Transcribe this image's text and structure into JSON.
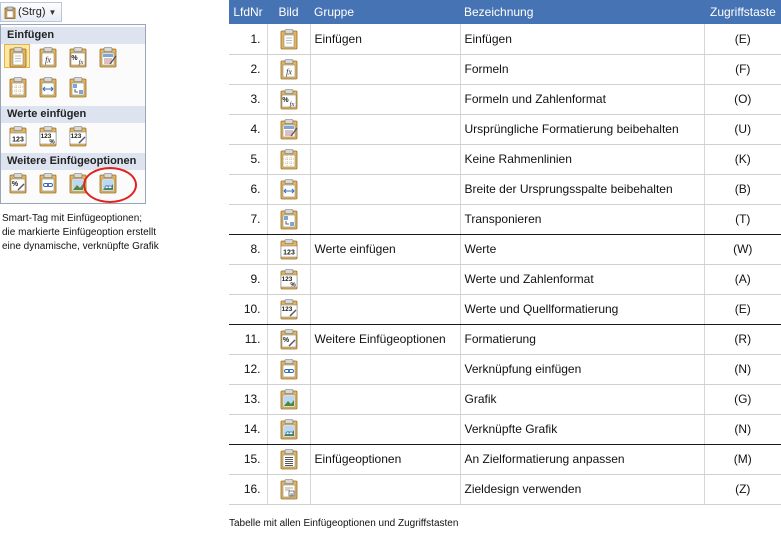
{
  "smart_tag": {
    "button_label": "(Strg)",
    "sections": [
      {
        "title": "Einfügen",
        "icons": [
          "paste-icon",
          "formula-fx-icon",
          "formula-number-format-icon",
          "keep-source-formatting-icon",
          "no-borders-icon",
          "keep-source-column-width-icon",
          "transpose-icon"
        ]
      },
      {
        "title": "Werte einfügen",
        "icons": [
          "values-icon",
          "values-number-format-icon",
          "values-source-formatting-icon"
        ]
      },
      {
        "title": "Weitere Einfügeoptionen",
        "icons": [
          "formatting-icon",
          "paste-link-icon",
          "picture-icon",
          "linked-picture-icon"
        ]
      }
    ],
    "caption": [
      "Smart-Tag mit Einfügeoptionen;",
      "die markierte Einfügeoption erstellt",
      "eine dynamische, verknüpfte Grafik"
    ]
  },
  "table": {
    "headers": {
      "nr": "LfdNr",
      "bild": "Bild",
      "gruppe": "Gruppe",
      "bezeichnung": "Bezeichnung",
      "taste": "Zugriffstaste"
    },
    "rows": [
      {
        "nr": "1.",
        "icon": "paste-icon",
        "gruppe": "Einfügen",
        "bezeichnung": "Einfügen",
        "taste": "(E)"
      },
      {
        "nr": "2.",
        "icon": "formula-fx-icon",
        "gruppe": "",
        "bezeichnung": "Formeln",
        "taste": "(F)"
      },
      {
        "nr": "3.",
        "icon": "formula-number-format-icon",
        "gruppe": "",
        "bezeichnung": "Formeln und Zahlenformat",
        "taste": "(O)"
      },
      {
        "nr": "4.",
        "icon": "keep-source-formatting-icon",
        "gruppe": "",
        "bezeichnung": "Ursprüngliche Formatierung beibehalten",
        "taste": "(U)"
      },
      {
        "nr": "5.",
        "icon": "no-borders-icon",
        "gruppe": "",
        "bezeichnung": "Keine Rahmenlinien",
        "taste": "(K)"
      },
      {
        "nr": "6.",
        "icon": "keep-source-column-width-icon",
        "gruppe": "",
        "bezeichnung": "Breite der Ursprungsspalte beibehalten",
        "taste": "(B)"
      },
      {
        "nr": "7.",
        "icon": "transpose-icon",
        "gruppe": "",
        "bezeichnung": "Transponieren",
        "taste": "(T)"
      },
      {
        "nr": "8.",
        "icon": "values-icon",
        "gruppe": "Werte einfügen",
        "bezeichnung": "Werte",
        "taste": "(W)"
      },
      {
        "nr": "9.",
        "icon": "values-number-format-icon",
        "gruppe": "",
        "bezeichnung": "Werte und Zahlenformat",
        "taste": "(A)"
      },
      {
        "nr": "10.",
        "icon": "values-source-formatting-icon",
        "gruppe": "",
        "bezeichnung": "Werte und Quellformatierung",
        "taste": "(E)"
      },
      {
        "nr": "11.",
        "icon": "formatting-icon",
        "gruppe": "Weitere Einfügeoptionen",
        "bezeichnung": "Formatierung",
        "taste": "(R)"
      },
      {
        "nr": "12.",
        "icon": "paste-link-icon",
        "gruppe": "",
        "bezeichnung": "Verknüpfung einfügen",
        "taste": "(N)"
      },
      {
        "nr": "13.",
        "icon": "picture-icon",
        "gruppe": "",
        "bezeichnung": "Grafik",
        "taste": "(G)"
      },
      {
        "nr": "14.",
        "icon": "linked-picture-icon",
        "gruppe": "",
        "bezeichnung": "Verknüpfte Grafik",
        "taste": "(N)"
      },
      {
        "nr": "15.",
        "icon": "match-destination-formatting-icon",
        "gruppe": "Einfügeoptionen",
        "bezeichnung": "An Zielformatierung anpassen",
        "taste": "(M)"
      },
      {
        "nr": "16.",
        "icon": "use-destination-theme-icon",
        "gruppe": "",
        "bezeichnung": "Zieldesign verwenden",
        "taste": "(Z)"
      }
    ],
    "caption": "Tabelle mit allen Einfügeoptionen und Zugriffstasten"
  },
  "colors": {
    "header_bg": "#4673b3",
    "selected_bg": "#fde7a4",
    "highlight_circle": "#e0221f"
  }
}
